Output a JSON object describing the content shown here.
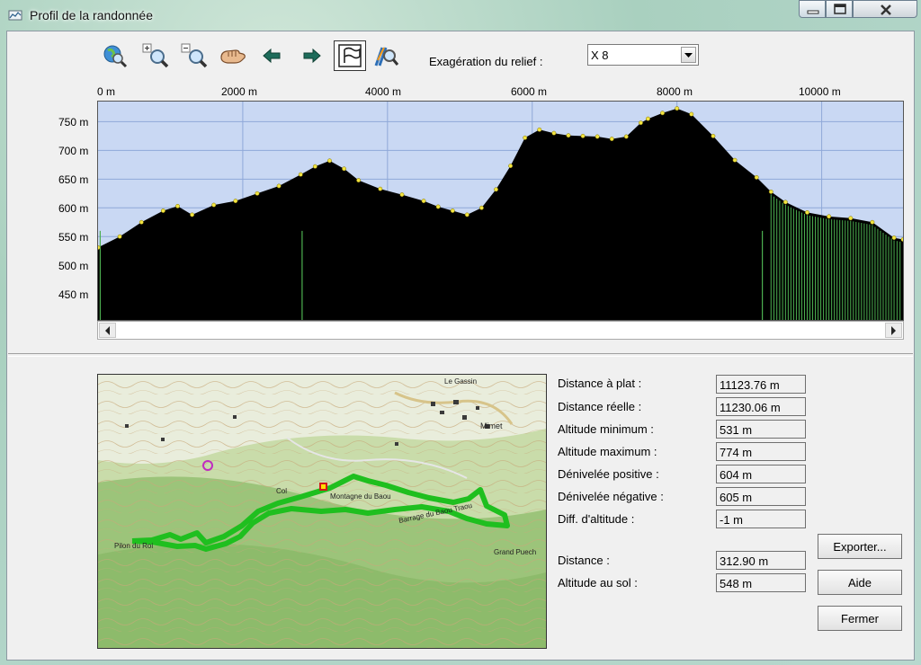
{
  "window": {
    "title": "Profil de la randonnée"
  },
  "toolbar": {
    "tools": [
      {
        "name": "globe-zoom-icon"
      },
      {
        "name": "zoom-in-icon"
      },
      {
        "name": "zoom-out-icon"
      },
      {
        "name": "pan-hand-icon"
      },
      {
        "name": "arrow-left-icon"
      },
      {
        "name": "arrow-right-icon"
      },
      {
        "name": "flag-icon",
        "pressed": true
      },
      {
        "name": "profile-search-icon"
      }
    ],
    "relief_label": "Exagération du relief :",
    "relief_value": "X 8"
  },
  "profile": {
    "x_ticks": [
      "0 m",
      "2000 m",
      "4000 m",
      "6000 m",
      "8000 m",
      "10000 m"
    ],
    "y_ticks": [
      "750 m",
      "700 m",
      "650 m",
      "600 m",
      "550 m",
      "500 m",
      "450 m"
    ],
    "colors": {
      "sky": "#c9d8f3",
      "terrain": "#000000",
      "ridge_points": "#f2e442",
      "markers": "#4caf50"
    }
  },
  "chart_data": {
    "type": "area",
    "xlabel": "",
    "ylabel": "",
    "xlim": [
      0,
      11123.76
    ],
    "ylim": [
      405,
      785
    ],
    "x": [
      0,
      300,
      600,
      900,
      1100,
      1300,
      1600,
      1900,
      2200,
      2500,
      2800,
      3000,
      3200,
      3400,
      3600,
      3900,
      4200,
      4500,
      4700,
      4900,
      5100,
      5300,
      5500,
      5700,
      5900,
      6100,
      6300,
      6500,
      6700,
      6900,
      7100,
      7300,
      7500,
      7600,
      7800,
      8000,
      8200,
      8500,
      8800,
      9100,
      9300,
      9500,
      9800,
      10100,
      10400,
      10700,
      11000,
      11124
    ],
    "y": [
      531,
      550,
      575,
      595,
      603,
      588,
      605,
      612,
      625,
      638,
      658,
      672,
      682,
      668,
      648,
      633,
      623,
      612,
      602,
      595,
      588,
      600,
      632,
      673,
      722,
      736,
      730,
      726,
      725,
      724,
      720,
      724,
      748,
      755,
      765,
      773,
      763,
      725,
      683,
      653,
      628,
      610,
      592,
      585,
      582,
      575,
      548,
      545
    ],
    "markers_x": [
      30,
      2820,
      9180
    ]
  },
  "map": {
    "labels": [
      "Pilon du Roi",
      "Col",
      "Montagne du Baou",
      "Barrage du Baou Traou",
      "Mimet",
      "Le Gassin",
      "Grand Puech"
    ]
  },
  "stats": [
    {
      "label": "Distance à plat :",
      "value": "11123.76 m"
    },
    {
      "label": "Distance réelle :",
      "value": "11230.06 m"
    },
    {
      "label": "Altitude minimum :",
      "value": "531 m"
    },
    {
      "label": "Altitude maximum :",
      "value": "774 m"
    },
    {
      "label": "Dénivelée positive :",
      "value": "604 m"
    },
    {
      "label": "Dénivelée négative :",
      "value": "605 m"
    },
    {
      "label": "Diff. d'altitude :",
      "value": "-1 m"
    }
  ],
  "cursor": [
    {
      "label": "Distance :",
      "value": "312.90 m"
    },
    {
      "label": "Altitude au sol :",
      "value": "548 m"
    }
  ],
  "buttons": {
    "export": "Exporter...",
    "help": "Aide",
    "close": "Fermer"
  }
}
